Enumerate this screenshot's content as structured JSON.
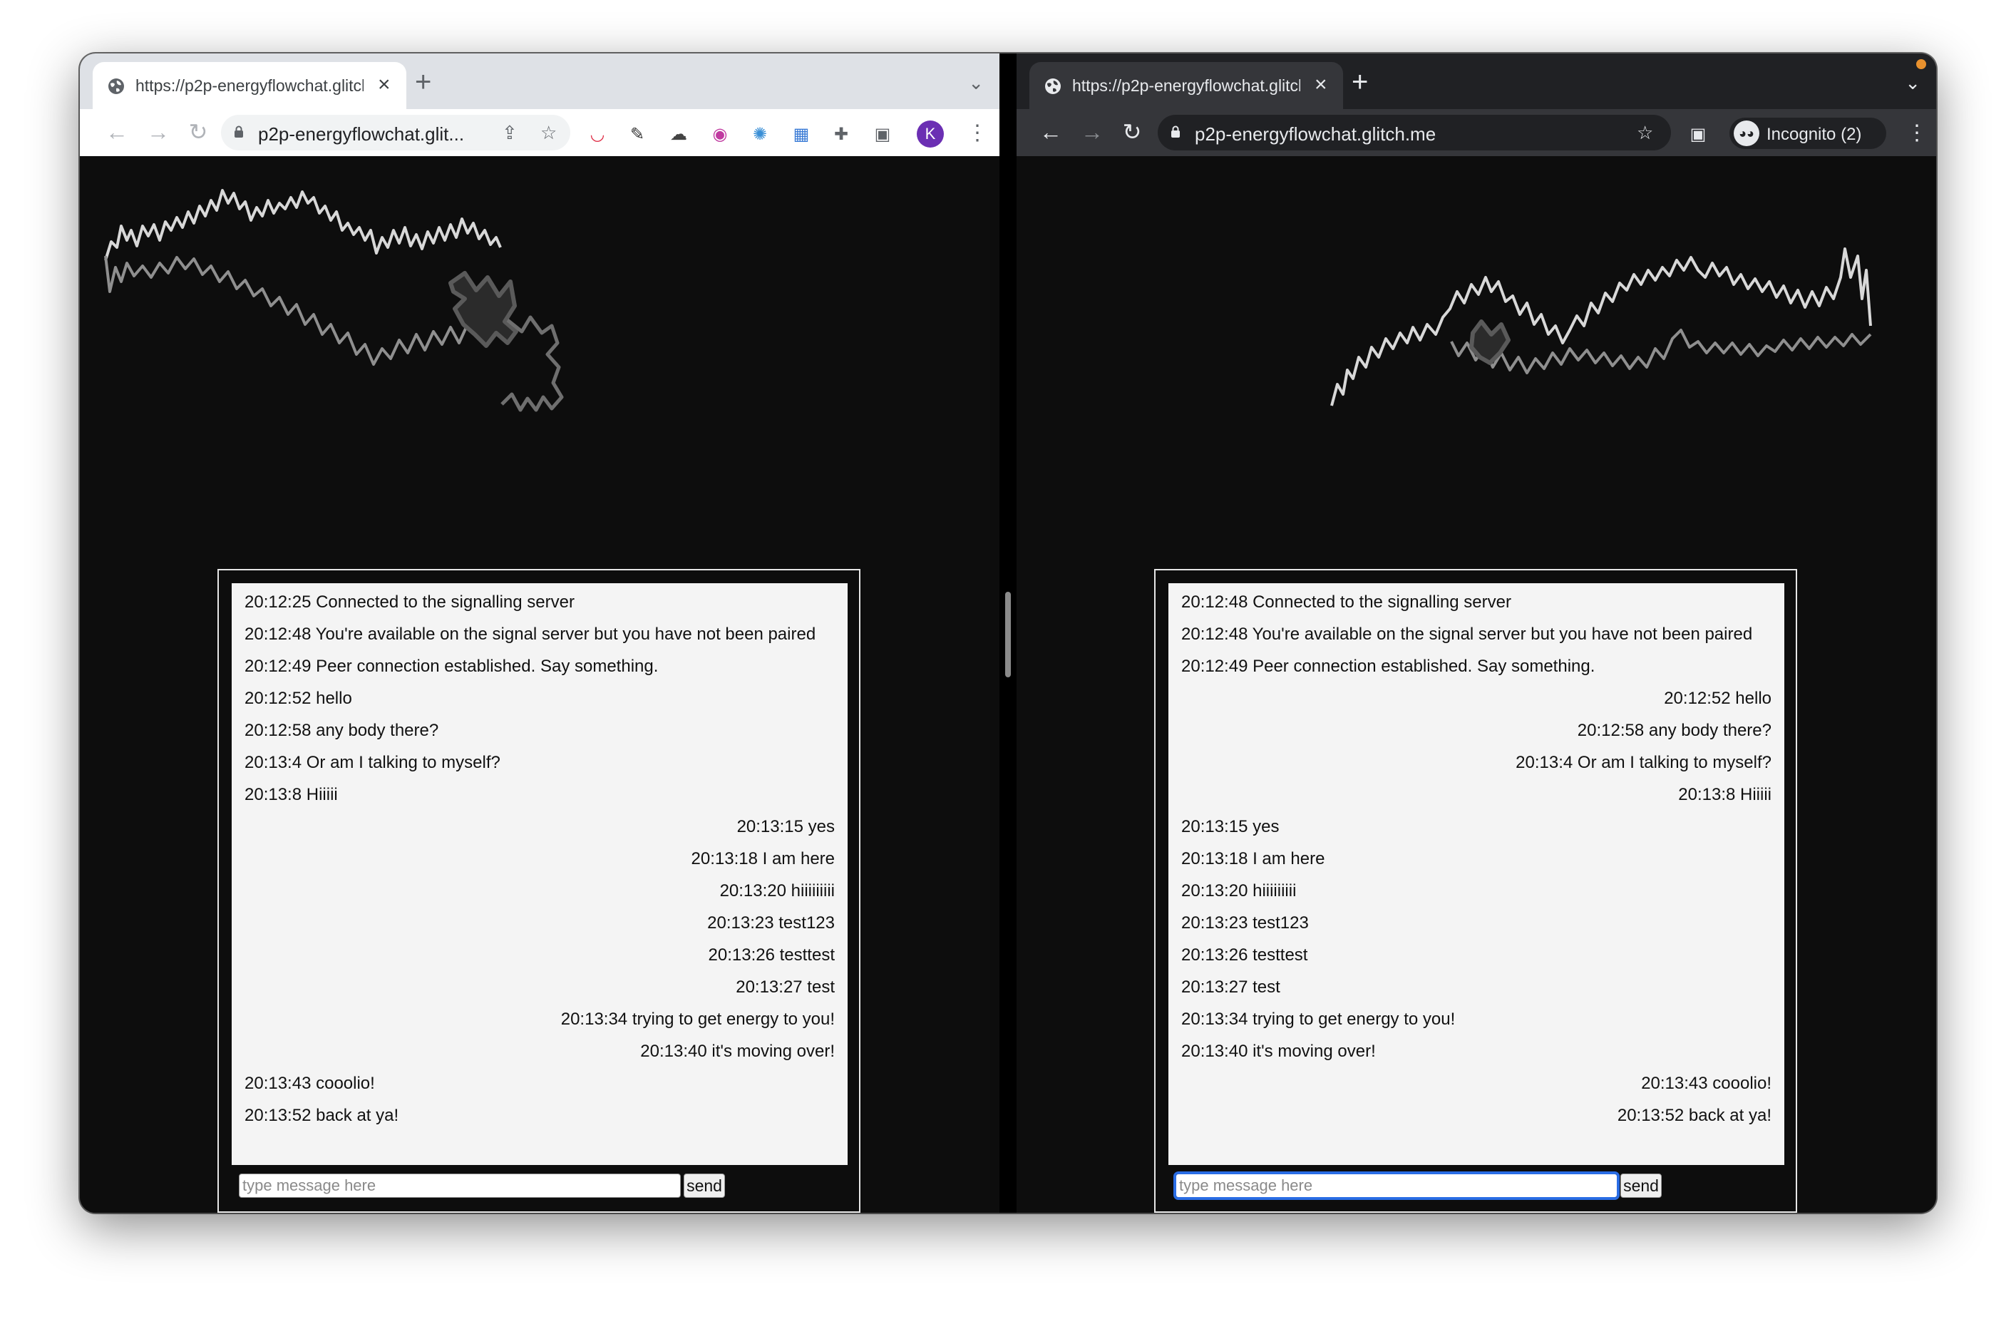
{
  "left": {
    "tab_title": "https://p2p-energyflowchat.glitch.me",
    "url": "p2p-energyflowchat.glit...",
    "avatar_initial": "K",
    "input_placeholder": "type message here",
    "send_label": "send",
    "messages": [
      {
        "text": "20:12:25 Connected to the signalling server",
        "side": "left"
      },
      {
        "text": "20:12:48 You're available on the signal server but you have not been paired",
        "side": "left"
      },
      {
        "text": "20:12:49 Peer connection established. Say something.",
        "side": "left"
      },
      {
        "text": "20:12:52 hello",
        "side": "left"
      },
      {
        "text": "20:12:58 any body there?",
        "side": "left"
      },
      {
        "text": "20:13:4 Or am I talking to myself?",
        "side": "left"
      },
      {
        "text": "20:13:8 Hiiiii",
        "side": "left"
      },
      {
        "text": "20:13:15 yes",
        "side": "right"
      },
      {
        "text": "20:13:18 I am here",
        "side": "right"
      },
      {
        "text": "20:13:20 hiiiiiiiii",
        "side": "right"
      },
      {
        "text": "20:13:23 test123",
        "side": "right"
      },
      {
        "text": "20:13:26 testtest",
        "side": "right"
      },
      {
        "text": "20:13:27 test",
        "side": "right"
      },
      {
        "text": "20:13:34 trying to get energy to you!",
        "side": "right"
      },
      {
        "text": "20:13:40 it's moving over!",
        "side": "right"
      },
      {
        "text": "20:13:43 cooolio!",
        "side": "left"
      },
      {
        "text": "20:13:52 back at ya!",
        "side": "left"
      }
    ]
  },
  "right": {
    "tab_title": "https://p2p-energyflowchat.glitch.me",
    "url": "p2p-energyflowchat.glitch.me",
    "incognito_label": "Incognito (2)",
    "input_placeholder": "type message here",
    "send_label": "send",
    "messages": [
      {
        "text": "20:12:48 Connected to the signalling server",
        "side": "left"
      },
      {
        "text": "20:12:48 You're available on the signal server but you have not been paired",
        "side": "left"
      },
      {
        "text": "20:12:49 Peer connection established. Say something.",
        "side": "left"
      },
      {
        "text": "20:12:52 hello",
        "side": "right"
      },
      {
        "text": "20:12:58 any body there?",
        "side": "right"
      },
      {
        "text": "20:13:4 Or am I talking to myself?",
        "side": "right"
      },
      {
        "text": "20:13:8 Hiiiii",
        "side": "right"
      },
      {
        "text": "20:13:15 yes",
        "side": "left"
      },
      {
        "text": "20:13:18 I am here",
        "side": "left"
      },
      {
        "text": "20:13:20 hiiiiiiiii",
        "side": "left"
      },
      {
        "text": "20:13:23 test123",
        "side": "left"
      },
      {
        "text": "20:13:26 testtest",
        "side": "left"
      },
      {
        "text": "20:13:27 test",
        "side": "left"
      },
      {
        "text": "20:13:34 trying to get energy to you!",
        "side": "left"
      },
      {
        "text": "20:13:40 it's moving over!",
        "side": "left"
      },
      {
        "text": "20:13:43 cooolio!",
        "side": "right"
      },
      {
        "text": "20:13:52 back at ya!",
        "side": "right"
      }
    ]
  },
  "icons": {
    "left_extensions": [
      "pocket-icon",
      "eyedropper-icon",
      "cloud-icon",
      "owl-icon",
      "react-icon",
      "layout-icon",
      "puzzle-icon",
      "reading-list-icon"
    ]
  }
}
